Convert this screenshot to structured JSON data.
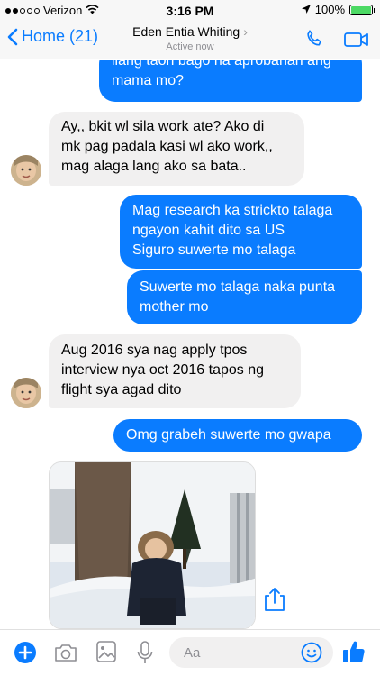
{
  "status_bar": {
    "carrier": "Verizon",
    "time": "3:16 PM",
    "battery": "100%"
  },
  "header": {
    "back_label": "Home (21)",
    "contact_name": "Eden Entia Whiting",
    "presence": "Active now"
  },
  "messages": [
    {
      "side": "outgoing",
      "lines": [
        "ilang taon bago na aprobahan ang",
        "mama mo?"
      ]
    },
    {
      "side": "incoming",
      "lines": [
        "Ay,,  bkit wl sila work ate?   Ako di",
        "mk pag padala kasi wl ako work,,",
        "mag alaga lang ako sa bata.."
      ]
    },
    {
      "side": "outgoing",
      "lines": [
        "Mag research ka strickto talaga",
        "ngayon kahit dito sa US",
        "Siguro suwerte mo talaga"
      ]
    },
    {
      "side": "outgoing",
      "lines": [
        "Suwerte mo talaga naka punta",
        "mother mo"
      ]
    },
    {
      "side": "incoming",
      "lines": [
        "Aug 2016 sya nag apply tpos",
        "interview nya oct  2016  tapos ng",
        "flight sya agad dito"
      ]
    },
    {
      "side": "outgoing",
      "lines": [
        "Omg grabeh suwerte mo gwapa"
      ]
    }
  ],
  "composer": {
    "placeholder": "Aa"
  },
  "colors": {
    "accent": "#0a7cff",
    "incoming_bubble": "#f1f0f0",
    "battery": "#4cd964"
  },
  "icons": [
    "wifi-icon",
    "location-icon",
    "phone-icon",
    "video-camera-icon",
    "plus-icon",
    "camera-icon",
    "image-icon",
    "microphone-icon",
    "emoji-icon",
    "thumbs-up-icon",
    "share-icon"
  ]
}
